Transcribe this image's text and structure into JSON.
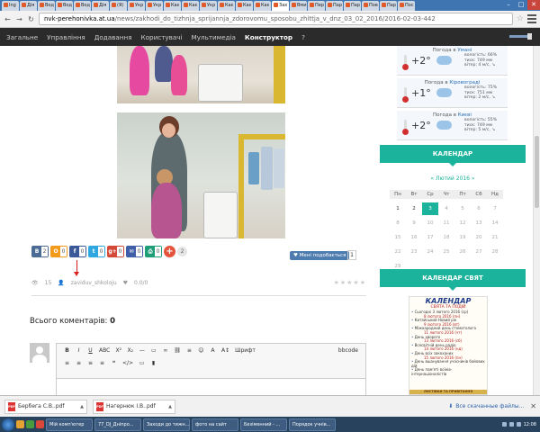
{
  "browser": {
    "tabs": [
      {
        "label": "Ing"
      },
      {
        "label": "Дія"
      },
      {
        "label": "Вод"
      },
      {
        "label": "Вод"
      },
      {
        "label": "Вод"
      },
      {
        "label": "Дія"
      },
      {
        "label": "(Я)"
      },
      {
        "label": "Укр"
      },
      {
        "label": "Укр"
      },
      {
        "label": "Кає"
      },
      {
        "label": "Кає"
      },
      {
        "label": "Укр"
      },
      {
        "label": "Кає"
      },
      {
        "label": "Кає"
      },
      {
        "label": "Кає"
      },
      {
        "label": "Зах"
      },
      {
        "label": "Вми"
      },
      {
        "label": "Пер"
      },
      {
        "label": "Пар"
      },
      {
        "label": "Пар"
      },
      {
        "label": "Пов"
      },
      {
        "label": "Пар"
      },
      {
        "label": "Пос"
      }
    ],
    "url_domain": "nvk-perehonivka.at.ua",
    "url_path": "/news/zakhodi_do_tizhnja_sprijannja_zdorovomu_sposobu_zhittja_v_dnz_03_02_2016/2016-02-03-442"
  },
  "sitenav": {
    "items": [
      "Загальне",
      "Управління",
      "Додавання",
      "Користувачі",
      "Мультимедіа",
      "Конструктор",
      "?"
    ]
  },
  "share": {
    "buttons": [
      {
        "icon": "В",
        "count": "2",
        "color": "#4b6b94"
      },
      {
        "icon": "О",
        "count": "0",
        "color": "#f29a1c"
      },
      {
        "icon": "f",
        "count": "0",
        "color": "#3b5998"
      },
      {
        "icon": "t",
        "count": "0",
        "color": "#2ea7e0"
      },
      {
        "icon": "g+",
        "count": "0",
        "color": "#d34836"
      },
      {
        "icon": "✉",
        "count": "0",
        "color": "#3f5fa8"
      },
      {
        "icon": "⎙",
        "count": "0",
        "color": "#1e9e77"
      }
    ],
    "plus_label": "+",
    "plus_count": "2"
  },
  "like": {
    "label": "Мені подобається",
    "count": "1"
  },
  "meta": {
    "views": "15",
    "author": "zaviduv_shkoloju",
    "rating": "0.0/0"
  },
  "comments": {
    "label": "Всього коментарів:",
    "count": "0"
  },
  "editor": {
    "row1": [
      "B",
      "I",
      "U",
      "ABC",
      "X²",
      "X₂",
      "—",
      "▭",
      "∞",
      "⛓",
      "≡",
      "☺",
      "A",
      "A↕",
      "Шрифт",
      "bbcode"
    ],
    "row2": [
      "≡",
      "≡",
      "≡",
      "≡",
      "❝",
      "</>",
      "▭",
      "▮"
    ]
  },
  "weather": [
    {
      "city": "Погода в",
      "city_name": "Умані",
      "temp": "+2°",
      "humidity": "вологість: 66%",
      "pressure": "тиск: 749 мм",
      "wind": "вітер: 4 м/с, ↘"
    },
    {
      "city": "Погода в",
      "city_name": "Кіровограді",
      "temp": "+1°",
      "humidity": "вологість: 75%",
      "pressure": "тиск: 751 мм",
      "wind": "вітер: 2 м/с, ↘"
    },
    {
      "city": "Погода в",
      "city_name": "Києві",
      "temp": "+2°",
      "humidity": "вологість: 55%",
      "pressure": "тиск: 749 мм",
      "wind": "вітер: 5 м/с, ↘"
    }
  ],
  "calendar": {
    "title": "КАЛЕНДАР",
    "month": "« Лютий 2016 »",
    "dow": [
      "Пн",
      "Вт",
      "Ср",
      "Чт",
      "Пт",
      "Сб",
      "Нд"
    ],
    "weeks": [
      [
        "1",
        "2",
        "3",
        "4",
        "5",
        "6",
        "7"
      ],
      [
        "8",
        "9",
        "10",
        "11",
        "12",
        "13",
        "14"
      ],
      [
        "15",
        "16",
        "17",
        "18",
        "19",
        "20",
        "21"
      ],
      [
        "22",
        "23",
        "24",
        "25",
        "26",
        "27",
        "28"
      ],
      [
        "29",
        "",
        "",
        "",
        "",
        "",
        ""
      ]
    ],
    "today": "3",
    "linked": [
      "1",
      "2",
      "3"
    ]
  },
  "holidays": {
    "title": "КАЛЕНДАР СВЯТ",
    "box_title": "КАЛЕНДАР",
    "box_subtitle": "СВЯТА ТА ПОДІЙ",
    "items": [
      {
        "text": "Сьогодні 3 лютого 2016 (ср)",
        "date": "8 лютого 2016 (пн)"
      },
      {
        "text": "Китайський Новий рік",
        "date": "9 лютого 2016 (вт)"
      },
      {
        "text": "Міжнародний день стоматолога",
        "date": "11 лютого 2016 (чт)"
      },
      {
        "text": "День хворого",
        "date": "13 лютого 2016 (сб)"
      },
      {
        "text": "Всесвітній день радіо",
        "date": "14 лютого 2016 (нд)"
      },
      {
        "text": "День всіх закоханих",
        "date": "15 лютого 2016 (пн)"
      },
      {
        "text": "День вшанування учасників бойових дій",
        "date": ""
      },
      {
        "text": "День пам'яті воїнів-інтернаціоналістів",
        "date": ""
      }
    ],
    "footer": "ЛИСТІВКИ ТА ПРИВІТАННЯ"
  },
  "downloads": {
    "files": [
      "Бербега С.В..pdf",
      "Нагернюк І.В..pdf"
    ],
    "show_all": "Все скачанные файлы..."
  },
  "taskbar": {
    "buttons": [
      "Мій комп'ютер",
      "77_DJ_Дніпро...",
      "Заходи до тижн...",
      "фото на сайт",
      "Безіменний - ...",
      "Порядок учнів..."
    ],
    "clock": "12:08"
  }
}
